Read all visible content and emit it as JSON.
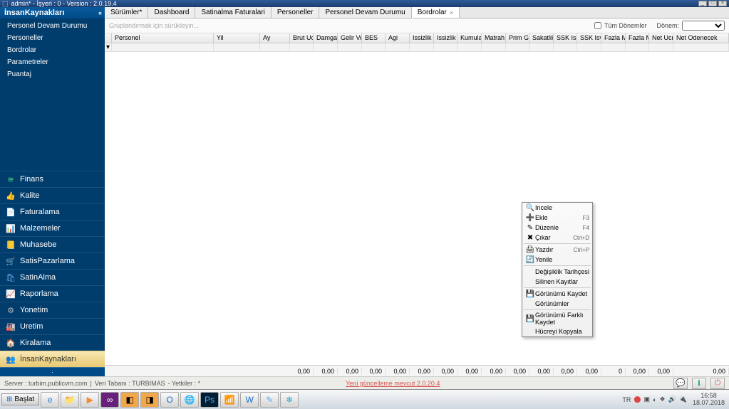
{
  "window": {
    "title": "admin* - İşyeri : 0 - Version : 2.0.19.4"
  },
  "sidebar": {
    "header": "İnsanKaynakları",
    "submenu": [
      "Personel Devam Durumu",
      "Personeller",
      "Bordrolar",
      "Parametreler",
      "Puantaj"
    ],
    "nav": [
      {
        "label": "Finans",
        "icon": "≋",
        "color": "#4bd97d"
      },
      {
        "label": "Kalite",
        "icon": "👍",
        "color": "#4bd97d"
      },
      {
        "label": "Faturalama",
        "icon": "📄",
        "color": "#e0e0e0"
      },
      {
        "label": "Malzemeler",
        "icon": "📊",
        "color": "#6aa8e8"
      },
      {
        "label": "Muhasebe",
        "icon": "📒",
        "color": "#8fa7c9"
      },
      {
        "label": "SatisPazarlama",
        "icon": "🛒",
        "color": "#f2a74b"
      },
      {
        "label": "SatinAlma",
        "icon": "🛍",
        "color": "#6aa8e8"
      },
      {
        "label": "Raporlama",
        "icon": "📈",
        "color": "#9078d6"
      },
      {
        "label": "Yonetim",
        "icon": "⚙",
        "color": "#bbb"
      },
      {
        "label": "Uretim",
        "icon": "🏭",
        "color": "#e85f5f"
      },
      {
        "label": "Kiralama",
        "icon": "🏠",
        "color": "#5bb878"
      },
      {
        "label": "İnsanKaynakları",
        "icon": "👥",
        "color": "#e8a95f",
        "active": true
      }
    ]
  },
  "tabs": [
    {
      "label": "Sürümler*"
    },
    {
      "label": "Dashboard"
    },
    {
      "label": "Satinalma Faturalari"
    },
    {
      "label": "Personeller"
    },
    {
      "label": "Personel Devam Durumu"
    },
    {
      "label": "Bordrolar",
      "active": true
    }
  ],
  "filterbar": {
    "placeholder": "Gruplandırmak için sürükleyin...",
    "tum_donemler": "Tüm Dönemler",
    "donem": "Dönem:"
  },
  "columns": [
    {
      "label": "Personel",
      "w": 143
    },
    {
      "label": "Yil",
      "w": 65
    },
    {
      "label": "Ay",
      "w": 42
    },
    {
      "label": "Brut Ucret",
      "w": 33
    },
    {
      "label": "Damga V...",
      "w": 34
    },
    {
      "label": "Gelir Vergisi",
      "w": 34
    },
    {
      "label": "BES",
      "w": 33
    },
    {
      "label": "Agi",
      "w": 34
    },
    {
      "label": "Issizlik Is...",
      "w": 34
    },
    {
      "label": "Issizlik Is...",
      "w": 33
    },
    {
      "label": "Kumulati...",
      "w": 34
    },
    {
      "label": "Matrah",
      "w": 34
    },
    {
      "label": "Prim Gunu",
      "w": 33
    },
    {
      "label": "Sakatlik I...",
      "w": 34
    },
    {
      "label": "SSK Isci ...",
      "w": 33
    },
    {
      "label": "SSK Isve...",
      "w": 34
    },
    {
      "label": "Fazla Me...",
      "w": 34
    },
    {
      "label": "Fazla Me...",
      "w": 33
    },
    {
      "label": "Net Ucret",
      "w": 34
    },
    {
      "label": "Net Odenecek",
      "w": 78
    }
  ],
  "context_menu": {
    "items1": [
      {
        "icon": "🔍",
        "label": "Incele",
        "shortcut": ""
      },
      {
        "icon": "➕",
        "label": "Ekle",
        "shortcut": "F3"
      },
      {
        "icon": "✎",
        "label": "Düzenle",
        "shortcut": "F4"
      },
      {
        "icon": "✖",
        "label": "Çıkar",
        "shortcut": "Ctrl+D"
      }
    ],
    "items2": [
      {
        "icon": "🖨",
        "label": "Yazdır",
        "shortcut": "Ctrl+P"
      },
      {
        "icon": "🔄",
        "label": "Yenile",
        "shortcut": ""
      }
    ],
    "items3": [
      {
        "icon": "",
        "label": "Değişiklik Tarihçesi",
        "shortcut": ""
      },
      {
        "icon": "",
        "label": "Silinen Kayıtlar",
        "shortcut": ""
      }
    ],
    "items4": [
      {
        "icon": "💾",
        "label": "Görünümü Kaydet",
        "shortcut": ""
      },
      {
        "icon": "",
        "label": "Görünümler",
        "shortcut": ""
      }
    ],
    "items5": [
      {
        "icon": "💾",
        "label": "Görünümü Farklı Kaydet",
        "shortcut": ""
      },
      {
        "icon": "",
        "label": "Hücreyi Kopyala",
        "shortcut": ""
      }
    ]
  },
  "totals": [
    "0,00",
    "0,00",
    "0,00",
    "0,00",
    "0,00",
    "0,00",
    "0,00",
    "0,00",
    "0,00",
    "0,00",
    "0,00",
    "0,00",
    "0,00",
    "0",
    "0,00",
    "0,00",
    "0,00"
  ],
  "statusbar": {
    "server": "Server : turbim.publicvm.com",
    "db": "Veri Tabanı : TURBIMAS",
    "yetkiler": "- Yetkiler : *",
    "update": "Yeni güncelleme mevcut 2.0.20.4"
  },
  "taskbar": {
    "start": "Başlat",
    "lang": "TR",
    "time": "16:58",
    "date": "18.07.2018"
  }
}
